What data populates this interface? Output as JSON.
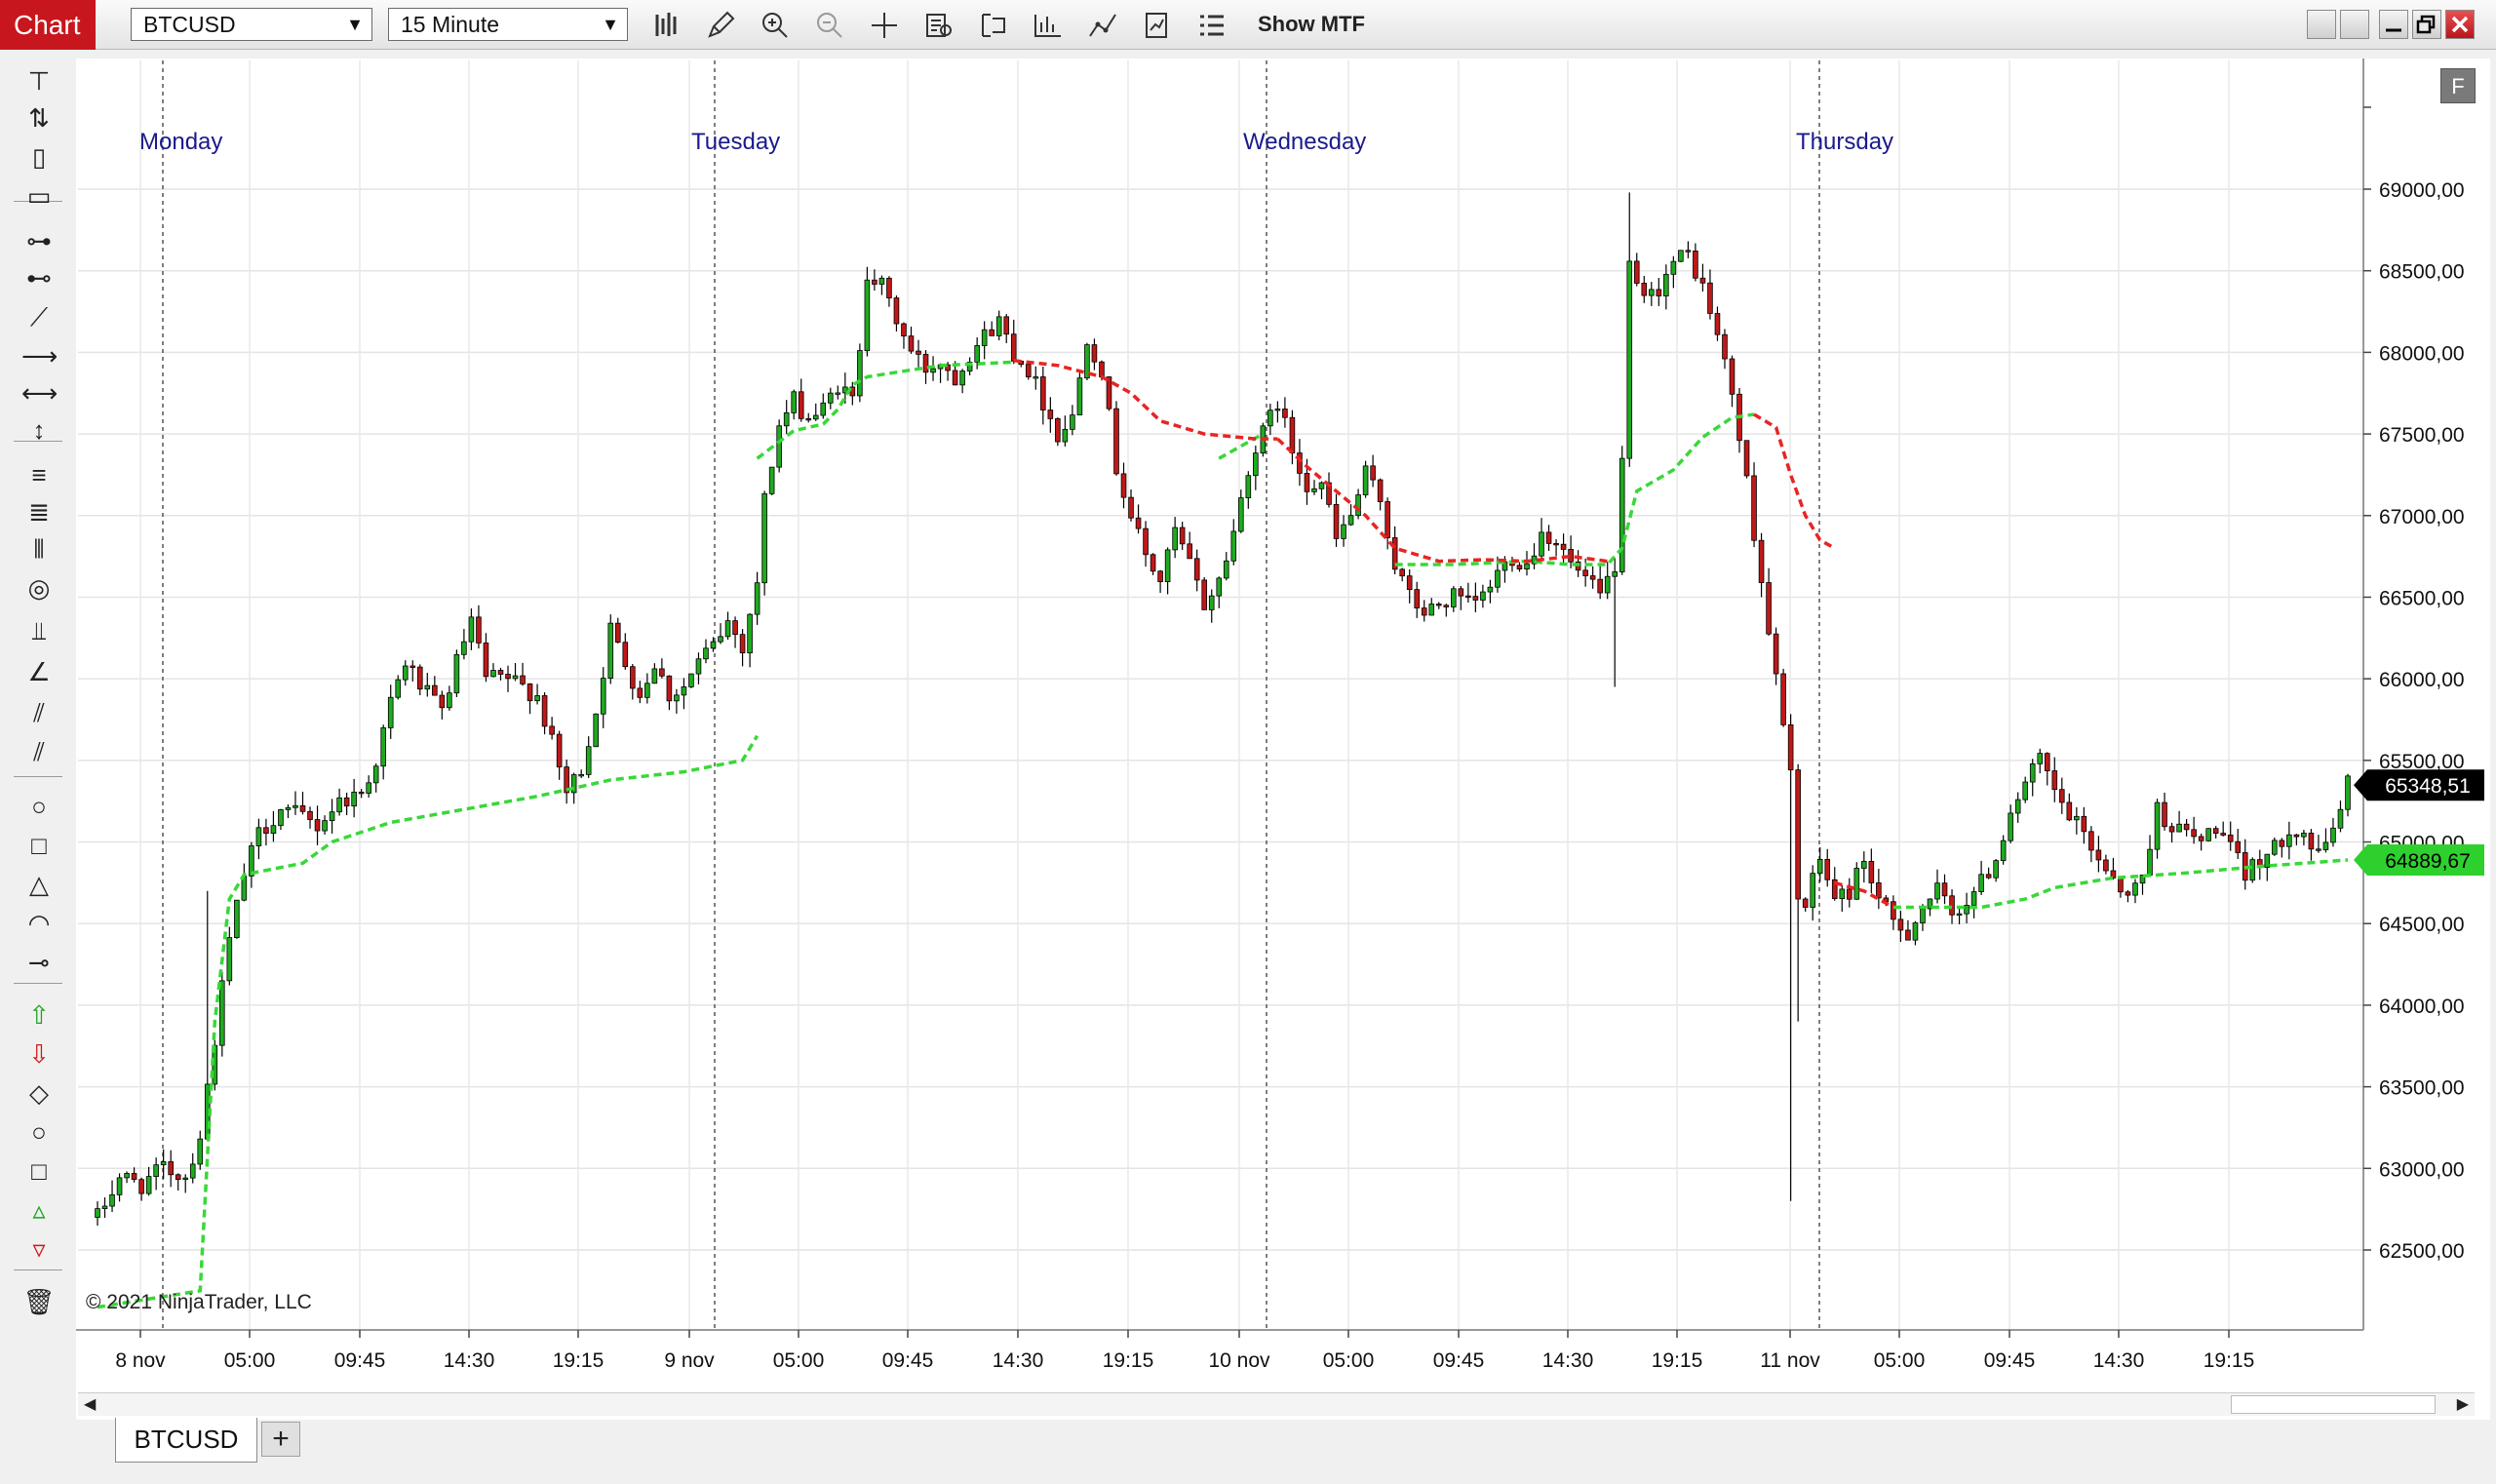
{
  "window": {
    "title_tab": "Chart",
    "symbol": "BTCUSD",
    "interval": "15 Minute",
    "show_mtf_label": "Show MTF"
  },
  "toolbar_icons": [
    "bar-type-icon",
    "draw-pencil-icon",
    "zoom-in-icon",
    "zoom-out-icon",
    "crosshair-icon",
    "data-box-icon",
    "indicators-icon",
    "strategies-icon",
    "trade-line-icon",
    "properties-icon",
    "chart-trader-icon"
  ],
  "left_tools": [
    "ruler-icon",
    "risk-reward-icon",
    "region-icon",
    "region-highlight-icon",
    "line-icon",
    "ray-icon",
    "extended-line-icon",
    "arrow-line-icon",
    "horizontal-line-icon",
    "vertical-line-icon",
    "fibonacci-retracement-icon",
    "fibonacci-extension-icon",
    "fibonacci-time-icon",
    "fibonacci-circle-icon",
    "andrews-pitchfork-icon",
    "gann-fan-icon",
    "regression-channel-icon",
    "trend-channel-icon",
    "ellipse-icon",
    "rectangle-icon",
    "triangle-icon",
    "arc-icon",
    "path-icon",
    "arrow-up-icon",
    "arrow-down-icon",
    "diamond-icon",
    "dot-icon",
    "square-icon",
    "triangle-up-icon",
    "triangle-down-icon",
    "remove-all-drawings-icon"
  ],
  "chart_data": {
    "type": "candlestick",
    "instrument": "BTCUSD",
    "bar_period": "15 Minute",
    "y_ticks": [
      69000,
      68500,
      68000,
      67500,
      67000,
      66500,
      66000,
      65500,
      65000,
      64500,
      64000,
      63500,
      63000,
      62500
    ],
    "y_tick_labels": [
      "69000,00",
      "68500,00",
      "68000,00",
      "67500,00",
      "67000,00",
      "66500,00",
      "66000,00",
      "65500,00",
      "65000,00",
      "64500,00",
      "64000,00",
      "63500,00",
      "63000,00",
      "62500,00"
    ],
    "ylim": [
      62200,
      69700
    ],
    "x_tick_labels": [
      "8 nov",
      "05:00",
      "09:45",
      "14:30",
      "19:15",
      "9 nov",
      "05:00",
      "09:45",
      "14:30",
      "19:15",
      "10 nov",
      "05:00",
      "09:45",
      "14:30",
      "19:15",
      "11 nov",
      "05:00",
      "09:45",
      "14:30",
      "19:15"
    ],
    "day_separators": [
      "Monday",
      "Tuesday",
      "Wednesday",
      "Thursday"
    ],
    "last_price": 65348.51,
    "last_price_label": "65348,51",
    "indicator_value": 64889.67,
    "indicator_value_label": "64889,67",
    "price_path": [
      [
        0,
        62700
      ],
      [
        3,
        62950
      ],
      [
        6,
        62900
      ],
      [
        9,
        63000
      ],
      [
        12,
        62950
      ],
      [
        14,
        63200
      ],
      [
        16,
        63800
      ],
      [
        18,
        64400
      ],
      [
        20,
        64800
      ],
      [
        22,
        65050
      ],
      [
        25,
        65200
      ],
      [
        28,
        65150
      ],
      [
        30,
        65100
      ],
      [
        33,
        65250
      ],
      [
        36,
        65300
      ],
      [
        38,
        65500
      ],
      [
        40,
        65850
      ],
      [
        42,
        66100
      ],
      [
        45,
        65900
      ],
      [
        47,
        65800
      ],
      [
        49,
        66100
      ],
      [
        51,
        66350
      ],
      [
        53,
        66000
      ],
      [
        56,
        66000
      ],
      [
        58,
        65950
      ],
      [
        60,
        65900
      ],
      [
        62,
        65600
      ],
      [
        64,
        65300
      ],
      [
        66,
        65450
      ],
      [
        68,
        65800
      ],
      [
        70,
        66300
      ],
      [
        72,
        66100
      ],
      [
        74,
        65900
      ],
      [
        76,
        66100
      ],
      [
        78,
        65900
      ],
      [
        80,
        65950
      ],
      [
        82,
        66100
      ],
      [
        84,
        66200
      ],
      [
        86,
        66350
      ],
      [
        88,
        66200
      ],
      [
        90,
        66600
      ],
      [
        91,
        67100
      ],
      [
        93,
        67550
      ],
      [
        95,
        67700
      ],
      [
        97,
        67600
      ],
      [
        99,
        67650
      ],
      [
        101,
        67800
      ],
      [
        103,
        67700
      ],
      [
        104,
        68050
      ],
      [
        105,
        68500
      ],
      [
        107,
        68400
      ],
      [
        109,
        68200
      ],
      [
        111,
        68000
      ],
      [
        113,
        67900
      ],
      [
        115,
        67950
      ],
      [
        117,
        67850
      ],
      [
        119,
        68000
      ],
      [
        121,
        68100
      ],
      [
        123,
        68200
      ],
      [
        125,
        68000
      ],
      [
        127,
        67900
      ],
      [
        129,
        67700
      ],
      [
        131,
        67500
      ],
      [
        133,
        67600
      ],
      [
        135,
        68100
      ],
      [
        137,
        67900
      ],
      [
        139,
        67300
      ],
      [
        141,
        67000
      ],
      [
        143,
        66750
      ],
      [
        145,
        66600
      ],
      [
        147,
        66900
      ],
      [
        149,
        66700
      ],
      [
        151,
        66450
      ],
      [
        153,
        66600
      ],
      [
        155,
        66900
      ],
      [
        157,
        67300
      ],
      [
        159,
        67500
      ],
      [
        161,
        67700
      ],
      [
        163,
        67400
      ],
      [
        165,
        67200
      ],
      [
        167,
        67200
      ],
      [
        169,
        66850
      ],
      [
        171,
        67000
      ],
      [
        173,
        67250
      ],
      [
        175,
        67100
      ],
      [
        177,
        66700
      ],
      [
        179,
        66500
      ],
      [
        181,
        66400
      ],
      [
        183,
        66450
      ],
      [
        185,
        66500
      ],
      [
        187,
        66450
      ],
      [
        189,
        66500
      ],
      [
        191,
        66650
      ],
      [
        193,
        66750
      ],
      [
        195,
        66700
      ],
      [
        197,
        66900
      ],
      [
        199,
        66850
      ],
      [
        201,
        66700
      ],
      [
        203,
        66600
      ],
      [
        205,
        66500
      ],
      [
        207,
        66700
      ],
      [
        208,
        67300
      ],
      [
        209,
        68500
      ],
      [
        211,
        68300
      ],
      [
        213,
        68400
      ],
      [
        215,
        68550
      ],
      [
        217,
        68600
      ],
      [
        219,
        68400
      ],
      [
        221,
        68100
      ],
      [
        223,
        67750
      ],
      [
        225,
        67200
      ],
      [
        227,
        66600
      ],
      [
        229,
        66000
      ],
      [
        231,
        65400
      ],
      [
        232,
        64700
      ],
      [
        233,
        64600
      ],
      [
        235,
        64900
      ],
      [
        237,
        64650
      ],
      [
        239,
        64700
      ],
      [
        241,
        64900
      ],
      [
        243,
        64650
      ],
      [
        245,
        64500
      ],
      [
        247,
        64450
      ],
      [
        249,
        64600
      ],
      [
        251,
        64700
      ],
      [
        253,
        64550
      ],
      [
        255,
        64650
      ],
      [
        257,
        64750
      ],
      [
        259,
        64900
      ],
      [
        261,
        65200
      ],
      [
        263,
        65350
      ],
      [
        265,
        65500
      ],
      [
        267,
        65300
      ],
      [
        269,
        65150
      ],
      [
        271,
        65050
      ],
      [
        273,
        64900
      ],
      [
        275,
        64800
      ],
      [
        277,
        64650
      ],
      [
        279,
        64800
      ],
      [
        281,
        65200
      ],
      [
        283,
        65100
      ],
      [
        285,
        65050
      ],
      [
        287,
        65000
      ],
      [
        289,
        65100
      ],
      [
        291,
        64950
      ],
      [
        293,
        64800
      ],
      [
        295,
        64900
      ],
      [
        297,
        64950
      ],
      [
        299,
        65100
      ],
      [
        301,
        65050
      ],
      [
        303,
        64900
      ],
      [
        305,
        65100
      ],
      [
        307,
        65350
      ]
    ],
    "green_vwap_segments": [
      [
        [
          0,
          62150
        ],
        [
          14,
          62250
        ],
        [
          16,
          63900
        ],
        [
          18,
          64650
        ],
        [
          20,
          64800
        ],
        [
          28,
          64870
        ],
        [
          32,
          65000
        ],
        [
          40,
          65120
        ],
        [
          50,
          65200
        ],
        [
          60,
          65280
        ],
        [
          70,
          65380
        ],
        [
          80,
          65430
        ],
        [
          88,
          65500
        ],
        [
          90,
          65650
        ]
      ],
      [
        [
          90,
          67350
        ],
        [
          95,
          67520
        ],
        [
          99,
          67560
        ],
        [
          101,
          67650
        ],
        [
          103,
          67800
        ],
        [
          105,
          67850
        ],
        [
          115,
          67920
        ],
        [
          125,
          67940
        ]
      ],
      [
        [
          153,
          67350
        ],
        [
          157,
          67450
        ],
        [
          159,
          67500
        ]
      ],
      [
        [
          177,
          66700
        ],
        [
          185,
          66700
        ],
        [
          195,
          66720
        ],
        [
          201,
          66700
        ],
        [
          206,
          66700
        ],
        [
          208,
          66800
        ],
        [
          210,
          67150
        ],
        [
          215,
          67280
        ],
        [
          219,
          67480
        ],
        [
          223,
          67600
        ],
        [
          226,
          67620
        ]
      ],
      [
        [
          245,
          64600
        ],
        [
          257,
          64600
        ],
        [
          263,
          64650
        ],
        [
          267,
          64720
        ],
        [
          275,
          64780
        ],
        [
          285,
          64810
        ],
        [
          295,
          64850
        ],
        [
          307,
          64890
        ]
      ]
    ],
    "red_vwap_segments": [
      [
        [
          125,
          67950
        ],
        [
          131,
          67920
        ],
        [
          137,
          67850
        ],
        [
          141,
          67750
        ],
        [
          145,
          67580
        ],
        [
          151,
          67500
        ],
        [
          158,
          67470
        ],
        [
          161,
          67470
        ]
      ],
      [
        [
          161,
          67470
        ],
        [
          165,
          67300
        ],
        [
          169,
          67150
        ],
        [
          173,
          67000
        ],
        [
          177,
          66800
        ],
        [
          183,
          66720
        ],
        [
          189,
          66730
        ],
        [
          195,
          66720
        ],
        [
          201,
          66750
        ],
        [
          206,
          66720
        ]
      ],
      [
        [
          226,
          67620
        ],
        [
          229,
          67540
        ],
        [
          231,
          67250
        ],
        [
          233,
          67000
        ],
        [
          235,
          66850
        ],
        [
          237,
          66800
        ]
      ],
      [
        [
          237,
          64750
        ],
        [
          241,
          64700
        ],
        [
          245,
          64600
        ]
      ]
    ]
  },
  "watermark": "© 2021 NinjaTrader, LLC",
  "f_button": "F",
  "bottom_tab": "BTCUSD",
  "add_tab": "+"
}
